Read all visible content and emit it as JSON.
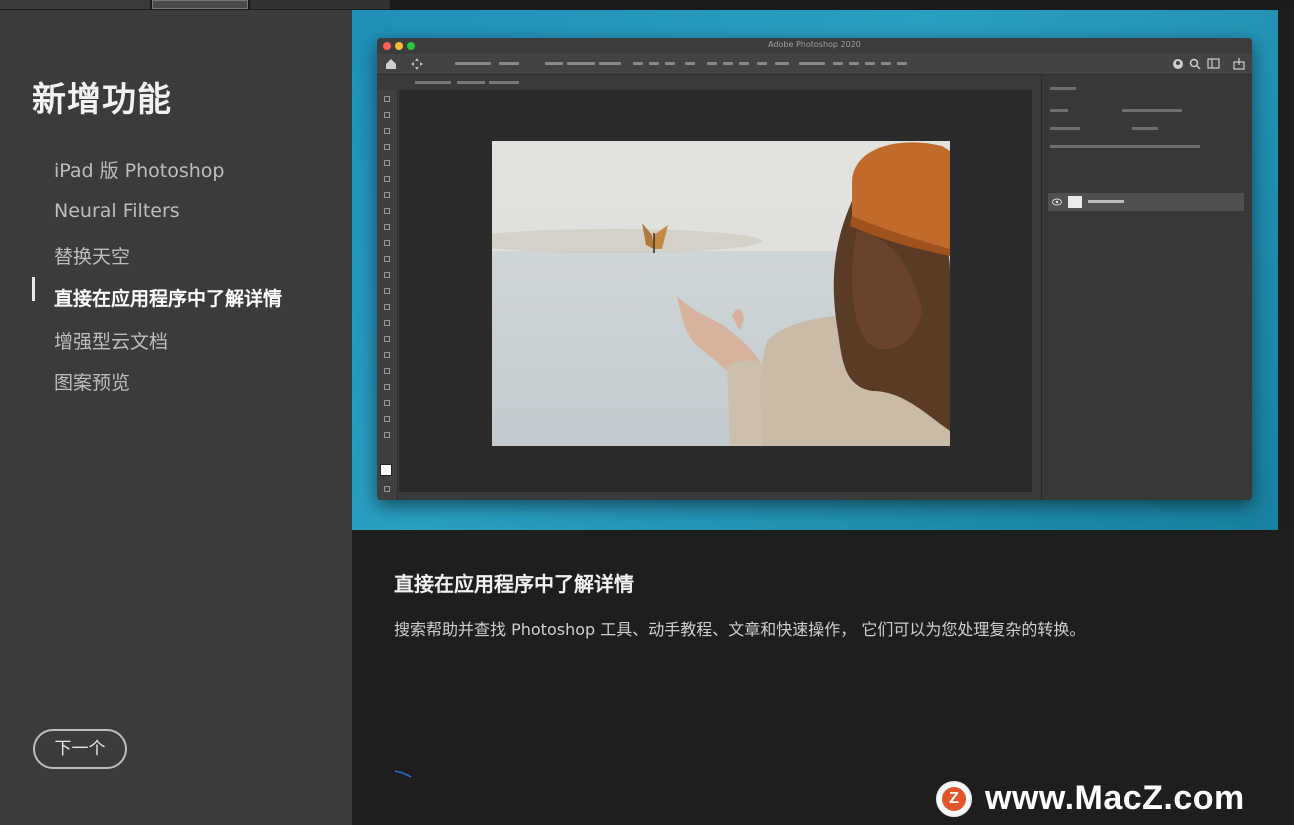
{
  "sidebar": {
    "title": "新增功能",
    "items": [
      {
        "label": "iPad 版 Photoshop",
        "active": false
      },
      {
        "label": "Neural Filters",
        "active": false
      },
      {
        "label": "替换天空",
        "active": false
      },
      {
        "label": "直接在应用程序中了解详情",
        "active": true
      },
      {
        "label": "增强型云文档",
        "active": false
      },
      {
        "label": "图案预览",
        "active": false
      }
    ],
    "next_label": "下一个"
  },
  "hero": {
    "app_window_title": "Adobe Photoshop 2020"
  },
  "content": {
    "title": "直接在应用程序中了解详情",
    "description": "搜索帮助并查找 Photoshop 工具、动手教程、文章和快速操作， 它们可以为您处理复杂的转换。"
  },
  "watermark": {
    "logo_letter": "Z",
    "text": "www.MacZ.com"
  },
  "colors": {
    "sidebar_bg": "#3b3b3b",
    "content_bg": "#1e1e1e",
    "hero_accent": "#2a9fc2",
    "watermark_logo": "#e2562d"
  }
}
